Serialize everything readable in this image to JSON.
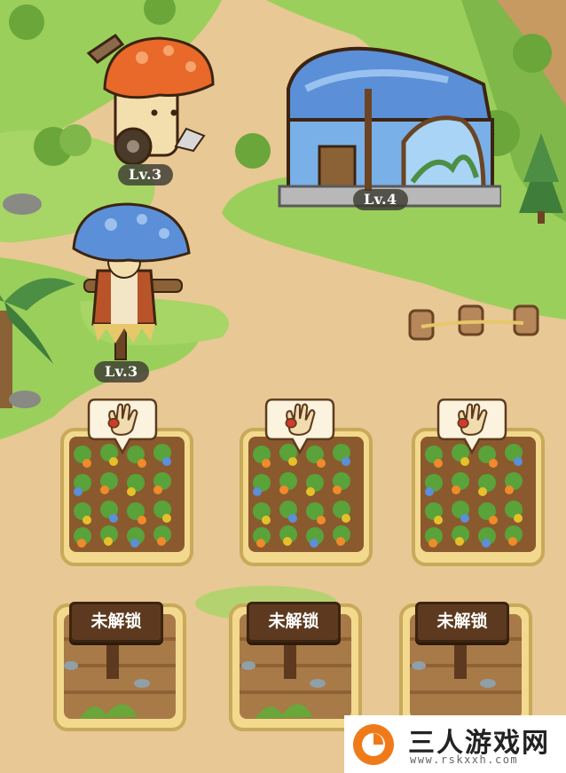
{
  "buildings": {
    "mower_level": "Lv.3",
    "greenhouse_level": "Lv.4",
    "scarecrow_level": "Lv.3"
  },
  "plots": {
    "harvest_icon": "glove-icon",
    "locked_label": "未解锁",
    "planted_count": 3,
    "locked_count": 3
  },
  "watermark": {
    "title": "三人游戏网",
    "url": "www.rskxxh.com"
  },
  "colors": {
    "path": "#e8c894",
    "grass": "#9bcf5b",
    "level_badge": "#3c3a32",
    "sign": "#5d3a1f",
    "watermark_logo": "#f07a1a"
  }
}
